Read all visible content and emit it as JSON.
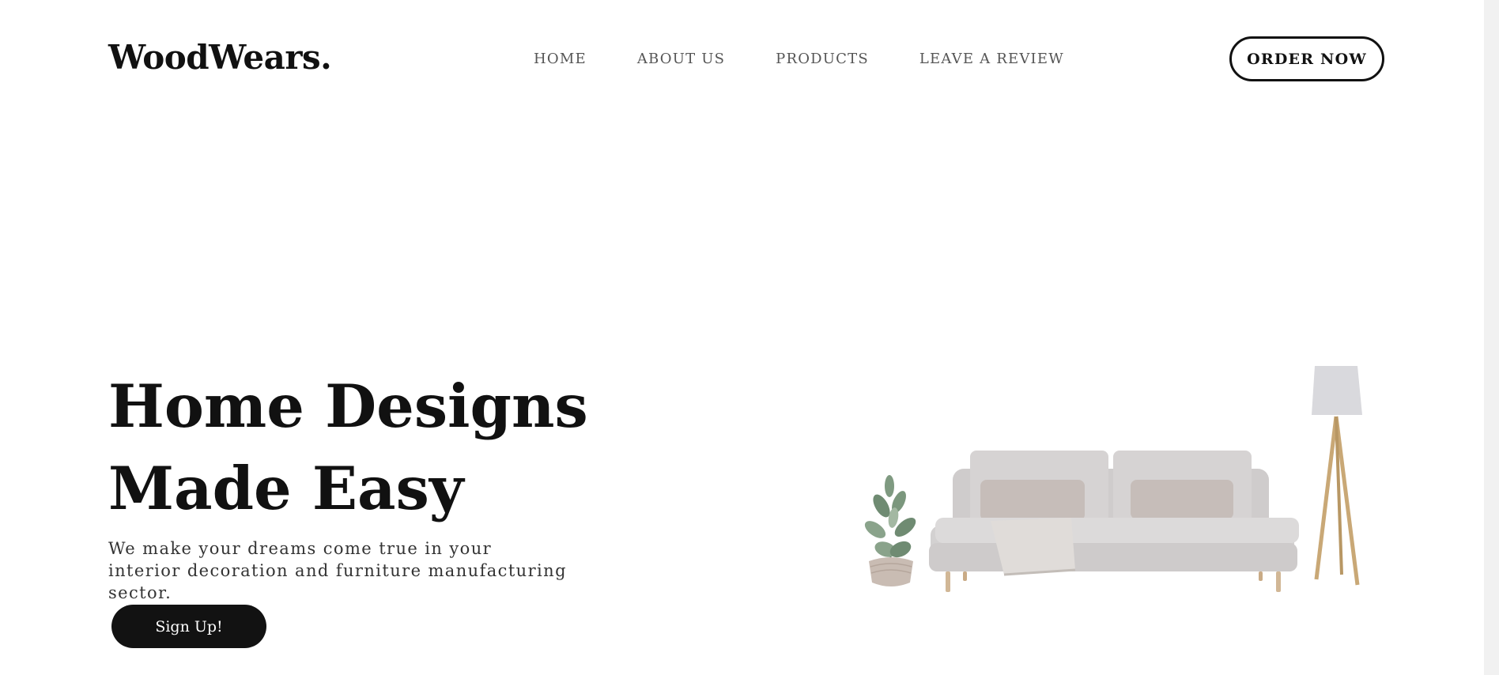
{
  "brand": {
    "logo": "WoodWears."
  },
  "nav": {
    "items": [
      {
        "label": "HOME"
      },
      {
        "label": "ABOUT US"
      },
      {
        "label": "PRODUCTS"
      },
      {
        "label": "LEAVE A REVIEW"
      }
    ]
  },
  "header": {
    "order_label": "ORDER NOW"
  },
  "hero": {
    "title_line1": "Home Designs",
    "title_line2": "Made Easy",
    "subtitle": "We make your dreams come true in your interior decoration and furniture manufacturing sector.",
    "cta_label": "Sign Up!"
  },
  "colors": {
    "text": "#111111",
    "nav_text": "#555555",
    "button_bg": "#121212",
    "sofa": "#d3d1d1",
    "lamp_shade": "#d9d9dd",
    "lamp_legs": "#c9a876",
    "plant_leaf": "#6f8b72",
    "pot": "#c9bcb3"
  }
}
